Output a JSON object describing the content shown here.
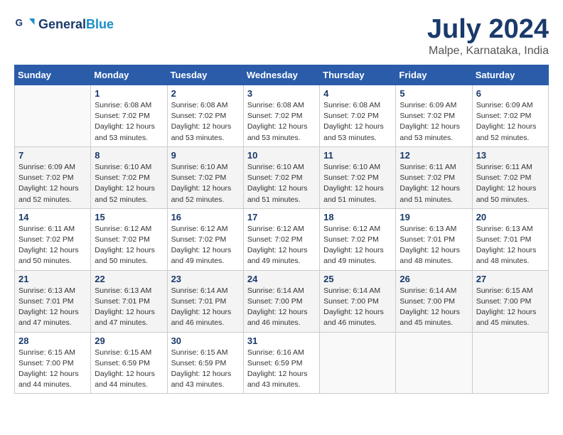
{
  "header": {
    "logo_line1": "General",
    "logo_line2": "Blue",
    "month_year": "July 2024",
    "location": "Malpe, Karnataka, India"
  },
  "weekdays": [
    "Sunday",
    "Monday",
    "Tuesday",
    "Wednesday",
    "Thursday",
    "Friday",
    "Saturday"
  ],
  "weeks": [
    [
      {
        "day": "",
        "info": ""
      },
      {
        "day": "1",
        "info": "Sunrise: 6:08 AM\nSunset: 7:02 PM\nDaylight: 12 hours\nand 53 minutes."
      },
      {
        "day": "2",
        "info": "Sunrise: 6:08 AM\nSunset: 7:02 PM\nDaylight: 12 hours\nand 53 minutes."
      },
      {
        "day": "3",
        "info": "Sunrise: 6:08 AM\nSunset: 7:02 PM\nDaylight: 12 hours\nand 53 minutes."
      },
      {
        "day": "4",
        "info": "Sunrise: 6:08 AM\nSunset: 7:02 PM\nDaylight: 12 hours\nand 53 minutes."
      },
      {
        "day": "5",
        "info": "Sunrise: 6:09 AM\nSunset: 7:02 PM\nDaylight: 12 hours\nand 53 minutes."
      },
      {
        "day": "6",
        "info": "Sunrise: 6:09 AM\nSunset: 7:02 PM\nDaylight: 12 hours\nand 52 minutes."
      }
    ],
    [
      {
        "day": "7",
        "info": "Sunrise: 6:09 AM\nSunset: 7:02 PM\nDaylight: 12 hours\nand 52 minutes."
      },
      {
        "day": "8",
        "info": "Sunrise: 6:10 AM\nSunset: 7:02 PM\nDaylight: 12 hours\nand 52 minutes."
      },
      {
        "day": "9",
        "info": "Sunrise: 6:10 AM\nSunset: 7:02 PM\nDaylight: 12 hours\nand 52 minutes."
      },
      {
        "day": "10",
        "info": "Sunrise: 6:10 AM\nSunset: 7:02 PM\nDaylight: 12 hours\nand 51 minutes."
      },
      {
        "day": "11",
        "info": "Sunrise: 6:10 AM\nSunset: 7:02 PM\nDaylight: 12 hours\nand 51 minutes."
      },
      {
        "day": "12",
        "info": "Sunrise: 6:11 AM\nSunset: 7:02 PM\nDaylight: 12 hours\nand 51 minutes."
      },
      {
        "day": "13",
        "info": "Sunrise: 6:11 AM\nSunset: 7:02 PM\nDaylight: 12 hours\nand 50 minutes."
      }
    ],
    [
      {
        "day": "14",
        "info": "Sunrise: 6:11 AM\nSunset: 7:02 PM\nDaylight: 12 hours\nand 50 minutes."
      },
      {
        "day": "15",
        "info": "Sunrise: 6:12 AM\nSunset: 7:02 PM\nDaylight: 12 hours\nand 50 minutes."
      },
      {
        "day": "16",
        "info": "Sunrise: 6:12 AM\nSunset: 7:02 PM\nDaylight: 12 hours\nand 49 minutes."
      },
      {
        "day": "17",
        "info": "Sunrise: 6:12 AM\nSunset: 7:02 PM\nDaylight: 12 hours\nand 49 minutes."
      },
      {
        "day": "18",
        "info": "Sunrise: 6:12 AM\nSunset: 7:02 PM\nDaylight: 12 hours\nand 49 minutes."
      },
      {
        "day": "19",
        "info": "Sunrise: 6:13 AM\nSunset: 7:01 PM\nDaylight: 12 hours\nand 48 minutes."
      },
      {
        "day": "20",
        "info": "Sunrise: 6:13 AM\nSunset: 7:01 PM\nDaylight: 12 hours\nand 48 minutes."
      }
    ],
    [
      {
        "day": "21",
        "info": "Sunrise: 6:13 AM\nSunset: 7:01 PM\nDaylight: 12 hours\nand 47 minutes."
      },
      {
        "day": "22",
        "info": "Sunrise: 6:13 AM\nSunset: 7:01 PM\nDaylight: 12 hours\nand 47 minutes."
      },
      {
        "day": "23",
        "info": "Sunrise: 6:14 AM\nSunset: 7:01 PM\nDaylight: 12 hours\nand 46 minutes."
      },
      {
        "day": "24",
        "info": "Sunrise: 6:14 AM\nSunset: 7:00 PM\nDaylight: 12 hours\nand 46 minutes."
      },
      {
        "day": "25",
        "info": "Sunrise: 6:14 AM\nSunset: 7:00 PM\nDaylight: 12 hours\nand 46 minutes."
      },
      {
        "day": "26",
        "info": "Sunrise: 6:14 AM\nSunset: 7:00 PM\nDaylight: 12 hours\nand 45 minutes."
      },
      {
        "day": "27",
        "info": "Sunrise: 6:15 AM\nSunset: 7:00 PM\nDaylight: 12 hours\nand 45 minutes."
      }
    ],
    [
      {
        "day": "28",
        "info": "Sunrise: 6:15 AM\nSunset: 7:00 PM\nDaylight: 12 hours\nand 44 minutes."
      },
      {
        "day": "29",
        "info": "Sunrise: 6:15 AM\nSunset: 6:59 PM\nDaylight: 12 hours\nand 44 minutes."
      },
      {
        "day": "30",
        "info": "Sunrise: 6:15 AM\nSunset: 6:59 PM\nDaylight: 12 hours\nand 43 minutes."
      },
      {
        "day": "31",
        "info": "Sunrise: 6:16 AM\nSunset: 6:59 PM\nDaylight: 12 hours\nand 43 minutes."
      },
      {
        "day": "",
        "info": ""
      },
      {
        "day": "",
        "info": ""
      },
      {
        "day": "",
        "info": ""
      }
    ]
  ]
}
